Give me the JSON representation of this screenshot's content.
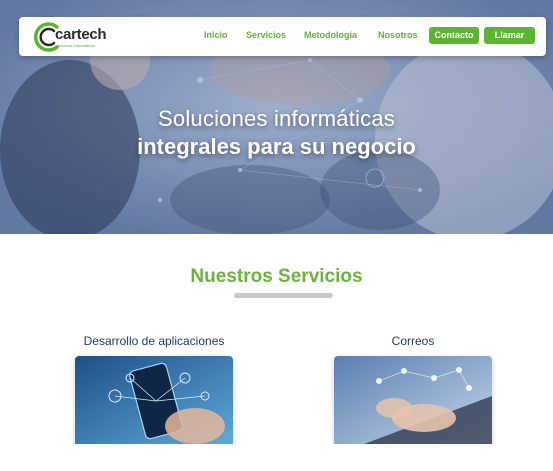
{
  "navbar": {
    "logo_text": "cartech",
    "logo_sub": "servicios informáticos",
    "links": [
      "Inicio",
      "Servicios",
      "Metodología",
      "Nosotros"
    ],
    "buttons": [
      "Contacto",
      "Llamar"
    ]
  },
  "hero": {
    "line1": "Soluciones informáticas",
    "line2": "integrales para su negocio"
  },
  "services": {
    "title": "Nuestros Servicios",
    "cards": [
      {
        "label": "Desarrollo de aplicaciones"
      },
      {
        "label": "Correos"
      }
    ]
  },
  "colors": {
    "brand_green": "#5cb531",
    "heading_blue": "#1f3a6b"
  }
}
